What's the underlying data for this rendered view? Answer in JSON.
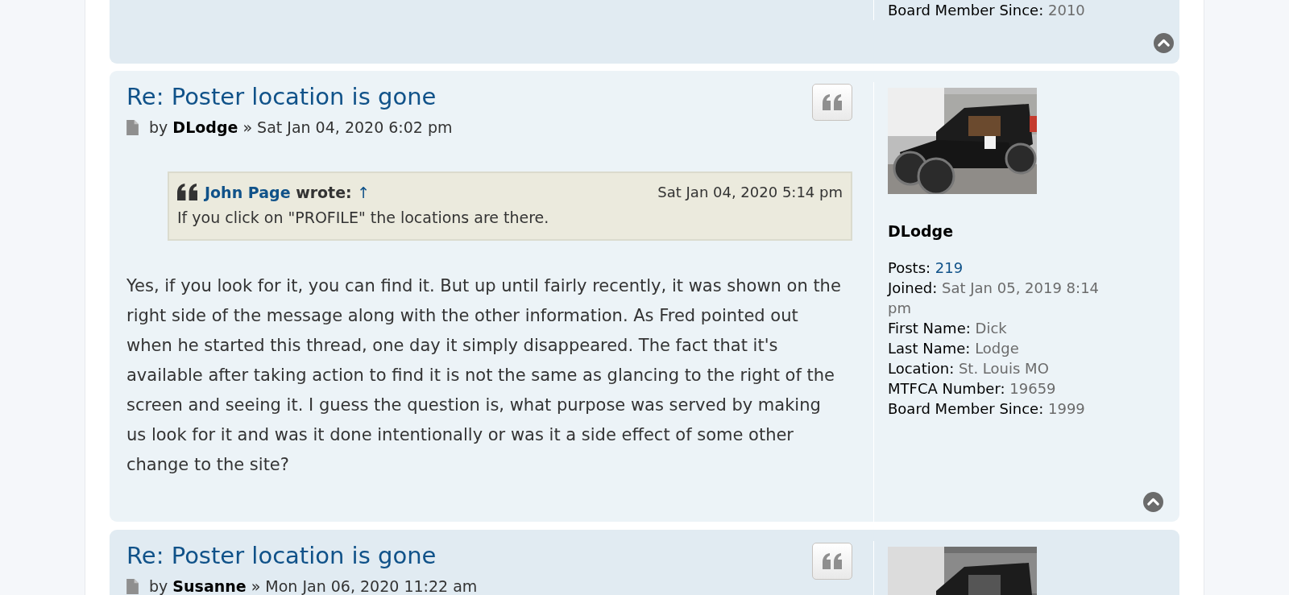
{
  "top_post": {
    "profile_fields": [
      {
        "label": "Board Member Since:",
        "value": "2010"
      }
    ]
  },
  "posts": [
    {
      "title": "Re: Poster location is gone",
      "by": "by",
      "author": "DLodge",
      "date": "» Sat Jan 04, 2020 6:02 pm",
      "quote": {
        "author": "John Page",
        "wrote": "wrote:",
        "jump": "↑",
        "date": "Sat Jan 04, 2020 5:14 pm",
        "text": "If you click on \"PROFILE\" the locations are there."
      },
      "body": "Yes, if you look for it, you can find it. But up until fairly recently, it was shown on the right side of the message along with the other information. As Fred pointed out when he started this thread, one day it simply disappeared. The fact that it's available after taking action to find it is not the same as glancing to the right of the screen and seeing it. I guess the question is, what purpose was served by making us look for it and was it done intentionally or was it a side effect of some other change to the site?",
      "profile_name": "DLodge",
      "profile_fields": [
        {
          "label": "Posts:",
          "value": "219",
          "link": true
        },
        {
          "label": "Joined:",
          "value": "Sat Jan 05, 2019 8:14 pm",
          "link": false
        },
        {
          "label": "First Name:",
          "value": "Dick",
          "link": false
        },
        {
          "label": "Last Name:",
          "value": "Lodge",
          "link": false
        },
        {
          "label": "Location:",
          "value": "St. Louis MO",
          "link": false
        },
        {
          "label": "MTFCA Number:",
          "value": "19659",
          "link": false
        },
        {
          "label": "Board Member Since:",
          "value": "1999",
          "link": false
        }
      ]
    },
    {
      "title": "Re: Poster location is gone",
      "by": "by",
      "author": "Susanne",
      "date": "» Mon Jan 06, 2020 11:22 am"
    }
  ]
}
